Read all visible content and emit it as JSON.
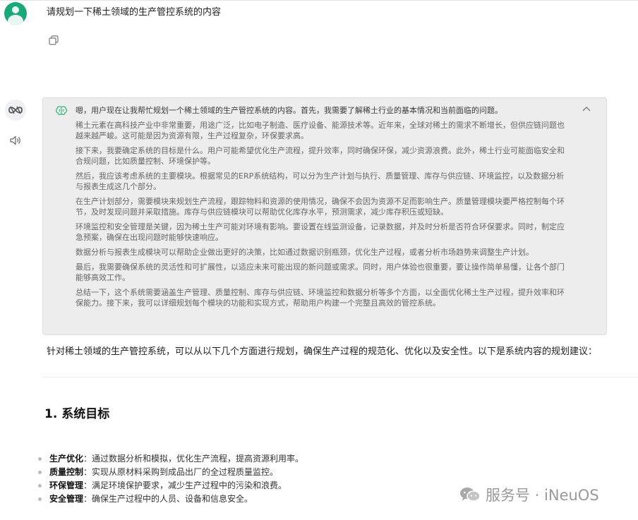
{
  "user": {
    "question": "请规划一下稀土领域的生产管控系统的内容"
  },
  "icons": {
    "user_avatar": "user-avatar-icon",
    "copy": "copy-icon",
    "bot_avatar": "bot-logo-icon",
    "speaker": "speaker-icon",
    "brain": "brain-icon",
    "collapse": "chevron-up-icon",
    "wechat": "wechat-icon"
  },
  "colors": {
    "user_avatar_bg": "#1aa87a",
    "think_bg": "#ededed",
    "think_text": "#666666",
    "brain_icon": "#2bb673"
  },
  "thinking": {
    "first_line": "嗯，用户现在让我帮忙规划一个稀土领域的生产管控系统的内容。首先，我需要了解稀土行业的基本情况和当前面临的问题。",
    "paragraphs": [
      "稀土元素在高科技产业中非常重要，用途广泛，比如电子制造、医疗设备、能源技术等。近年来，全球对稀土的需求不断增长，但供应链问题也越来越严峻。这可能是因为资源有限，生产过程复杂，环保要求高。",
      "接下来，我要确定系统的目标是什么。用户可能希望优化生产流程，提升效率，同时确保环保，减少资源浪费。此外，稀土行业可能面临安全和合规问题，比如质量控制、环境保护等。",
      "然后，我应该考虑系统的主要模块。根据常见的ERP系统结构，可以分为生产计划与执行、质量管理、库存与供应链、环境监控，以及数据分析与报表生成这几个部分。",
      "在生产计划部分，需要模块来规划生产流程，跟踪物料和资源的使用情况，确保不会因为资源不足而影响生产。质量管理模块要严格控制每个环节，及时发现问题并采取措施。库存与供应链模块可以帮助优化库存水平，预测需求，减少库存积压或短缺。",
      "环境监控和安全管理是关键，因为稀土生产可能对环境有影响。要设置在线监测设备，记录数据，并及时分析是否符合环保要求。同时，制定应急预案，确保在出现问题时能够快速响应。",
      "数据分析与报表生成模块可以帮助企业做出更好的决策，比如通过数据识别瓶颈，优化生产过程，或者分析市场趋势来调整生产计划。",
      "最后，我需要确保系统的灵活性和可扩展性，以适应未来可能出现的新问题或需求。同时，用户体验也很重要，要让操作简单易懂，让各个部门能够高效工作。",
      "总结一下，这个系统需要涵盖生产管理、质量控制、库存与供应链、环境监控和数据分析等多个方面，以全面优化稀土生产过程，提升效率和环保能力。接下来，我可以详细规划每个模块的功能和实现方式，帮助用户构建一个完整且高效的管控系统。"
    ]
  },
  "answer": {
    "intro": "针对稀土领域的生产管控系统，可以从以下几个方面进行规划，确保生产过程的规范化、优化以及安全性。以下是系统内容的规划建议：",
    "section_title": "1. 系统目标",
    "goals": [
      {
        "term": "生产优化",
        "desc": "：通过数据分析和模拟，优化生产流程，提高资源利用率。"
      },
      {
        "term": "质量控制",
        "desc": "：实现从原材料采购到成品出厂的全过程质量监控。"
      },
      {
        "term": "环保管理",
        "desc": "：满足环境保护要求，减少生产过程中的污染和浪费。"
      },
      {
        "term": "安全管理",
        "desc": "：确保生产过程中的人员、设备和信息安全。"
      }
    ]
  },
  "watermark": {
    "text": "服务号 · iNeuOS"
  }
}
